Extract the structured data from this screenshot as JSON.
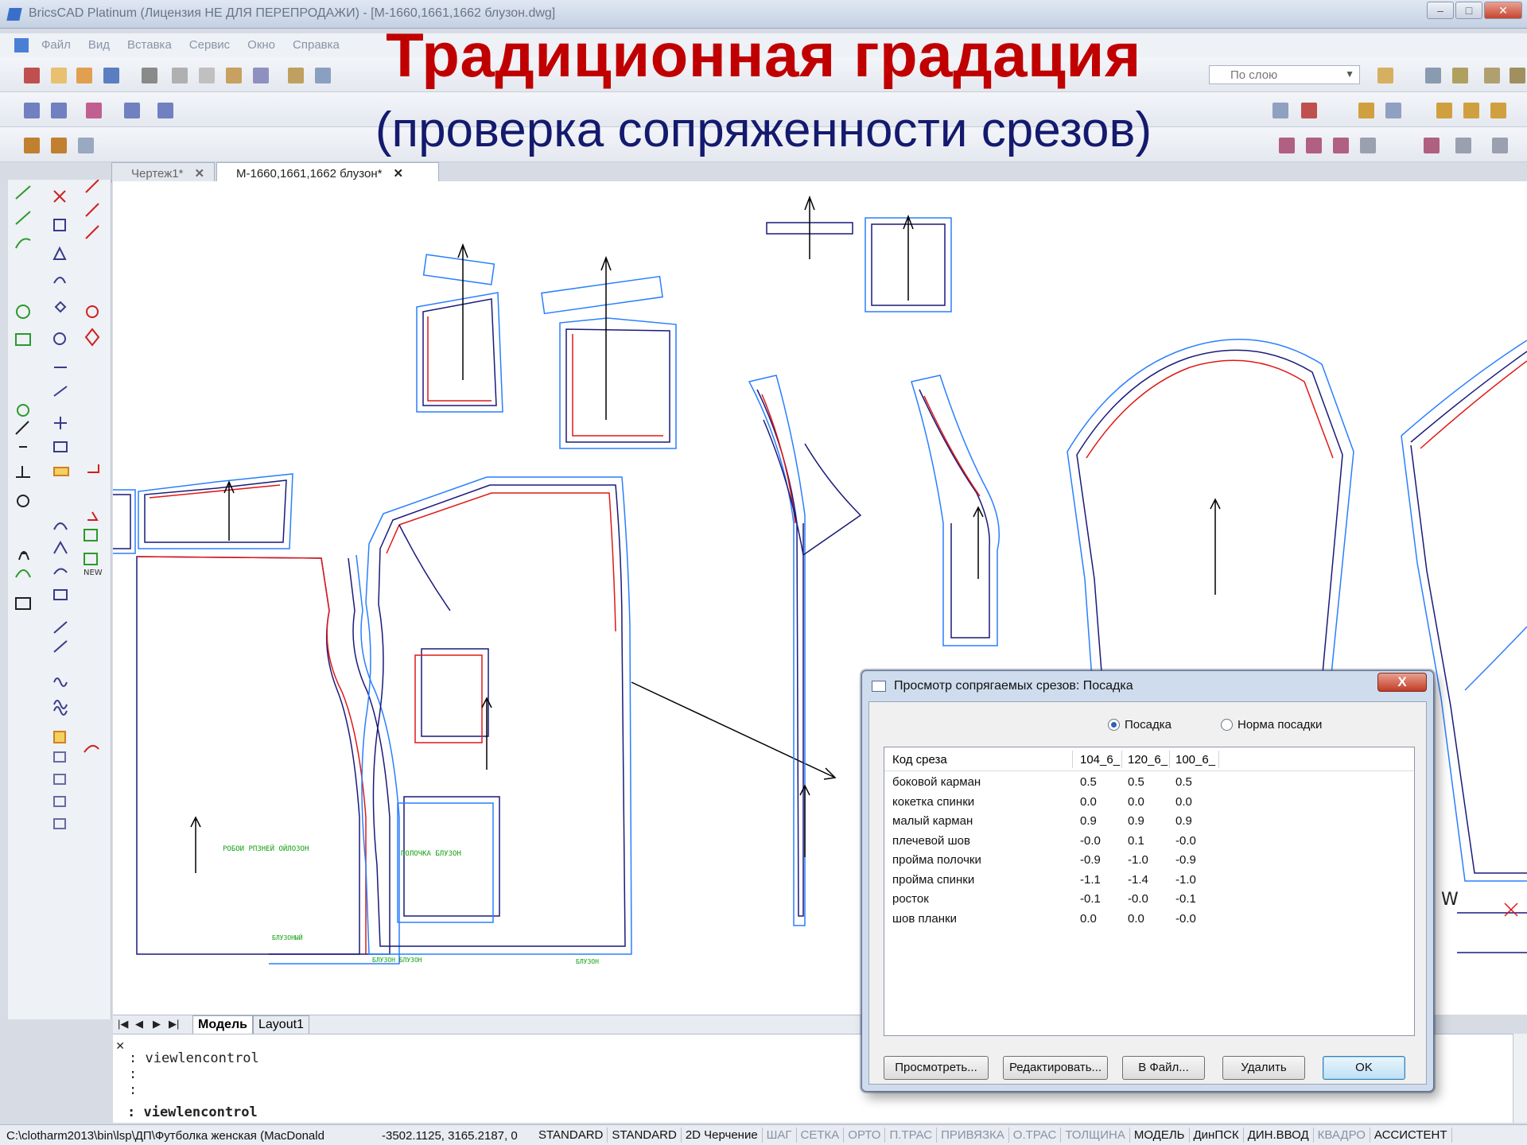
{
  "window": {
    "title": "BricsCAD Platinum (Лицензия НЕ ДЛЯ ПЕРЕПРОДАЖИ) - [М-1660,1661,1662 блузон.dwg]"
  },
  "menu": [
    "Файл",
    "Вид",
    "Вставка",
    "Сервис",
    "Окно",
    "Справка"
  ],
  "overlay": {
    "title": "Традиционная градация",
    "subtitle": "(проверка сопряженности срезов)"
  },
  "toolbar": {
    "layer_combo": "По слою",
    "layer_partial": "По слою"
  },
  "tabs": [
    {
      "label": "Чертеж1*"
    },
    {
      "label": "М-1660,1661,1662 блузон*"
    }
  ],
  "layout_tabs": [
    "Модель",
    "Layout1"
  ],
  "command_line": {
    "lines": [
      "viewlencontrol",
      ":",
      ":"
    ],
    "prompt": ": viewlencontrol"
  },
  "statusbar": {
    "path": "C:\\clotharm2013\\bin\\lsp\\ДП\\Футболка женская (MacDonald",
    "coords": "-3502.1125, 3165.2187, 0",
    "toggles": [
      {
        "label": "STANDARD",
        "on": true
      },
      {
        "label": "STANDARD",
        "on": true
      },
      {
        "label": "2D Черчение",
        "on": true
      },
      {
        "label": "ШАГ",
        "on": false
      },
      {
        "label": "СЕТКА",
        "on": false
      },
      {
        "label": "ОРТО",
        "on": false
      },
      {
        "label": "П.ТРАС",
        "on": false
      },
      {
        "label": "ПРИВЯЗКА",
        "on": false
      },
      {
        "label": "О.ТРАС",
        "on": false
      },
      {
        "label": "ТОЛЩИНА",
        "on": false
      },
      {
        "label": "МОДЕЛЬ",
        "on": true
      },
      {
        "label": "ДинПСК",
        "on": true
      },
      {
        "label": "ДИН.ВВОД",
        "on": true
      },
      {
        "label": "КВАДРО",
        "on": false
      },
      {
        "label": "АССИСТЕНТ",
        "on": true
      }
    ]
  },
  "dialog": {
    "title": "Просмотр сопрягаемых срезов: Посадка",
    "close": "X",
    "radio_fit": "Посадка",
    "radio_norm": "Норма посадки",
    "columns": [
      "Код среза",
      "104_6_",
      "120_6_",
      "100_6_"
    ],
    "rows": [
      {
        "name": "боковой карман",
        "v1": "0.5",
        "v2": "0.5",
        "v3": "0.5"
      },
      {
        "name": "кокетка спинки",
        "v1": "0.0",
        "v2": "0.0",
        "v3": "0.0"
      },
      {
        "name": "малый карман",
        "v1": "0.9",
        "v2": "0.9",
        "v3": "0.9"
      },
      {
        "name": "плечевой шов",
        "v1": "-0.0",
        "v2": "0.1",
        "v3": "-0.0"
      },
      {
        "name": "пройма полочки",
        "v1": "-0.9",
        "v2": "-1.0",
        "v3": "-0.9"
      },
      {
        "name": "пройма спинки",
        "v1": "-1.1",
        "v2": "-1.4",
        "v3": "-1.0"
      },
      {
        "name": "росток",
        "v1": "-0.1",
        "v2": "-0.0",
        "v3": "-0.1"
      },
      {
        "name": "шов планки",
        "v1": "0.0",
        "v2": "0.0",
        "v3": "-0.0"
      }
    ],
    "buttons": {
      "view": "Просмотреть...",
      "edit": "Редактировать...",
      "to_file": "В Файл...",
      "delete": "Удалить",
      "ok": "OK"
    }
  },
  "canvas_labels": {
    "back_piece": "РОБОИ РПЗНЕЙ ОЙЛОЗОН",
    "back_bottom": "БЛУЗОНЫЙ",
    "front_label": "ПОЛОЧКА БЛУЗОН",
    "front_bottom_a": "БЛУЗОН БЛУЗОН",
    "front_bottom_b": "БЛУЗОН",
    "w_mark": "W"
  },
  "colors": {
    "outline_dark": "#1a1a7a",
    "outline_blue": "#2a7fff",
    "outline_red": "#e01818",
    "green_text": "#12a012",
    "title_red": "#c00000",
    "subtitle_navy": "#141a6e"
  }
}
